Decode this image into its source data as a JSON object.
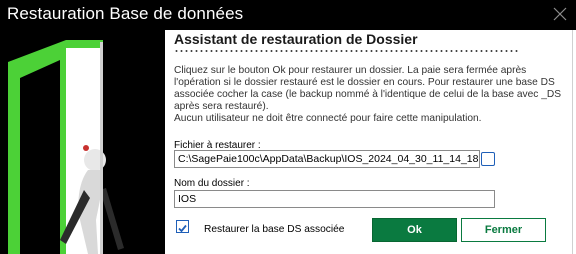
{
  "window": {
    "title": "Restauration Base de données"
  },
  "dialog": {
    "heading": "Assistant de restauration de Dossier",
    "description": [
      "Cliquez sur le bouton Ok pour restaurer un dossier. La paie sera fermée après l'opération si le dossier restauré est le dossier en cours. Pour restaurer une base DS associée cocher la case (le backup nommé à l'identique de celui de la base avec _DS après sera restauré).",
      "Aucun utilisateur ne doit être connecté pour faire cette manipulation."
    ],
    "file_label": "Fichier à restaurer :",
    "file_value": "C:\\SagePaie100c\\AppData\\Backup\\IOS_2024_04_30_11_14_18",
    "folder_label": "Nom du dossier :",
    "folder_value": "IOS",
    "checkbox_label": "Restaurer la base DS associée",
    "checkbox_checked": true,
    "ok_label": "Ok",
    "cancel_label": "Fermer"
  },
  "colors": {
    "titlebar": "#000000",
    "accent_green": "#0a7a40",
    "checkbox_blue": "#1f5fb8",
    "door_green": "#4cd137"
  }
}
